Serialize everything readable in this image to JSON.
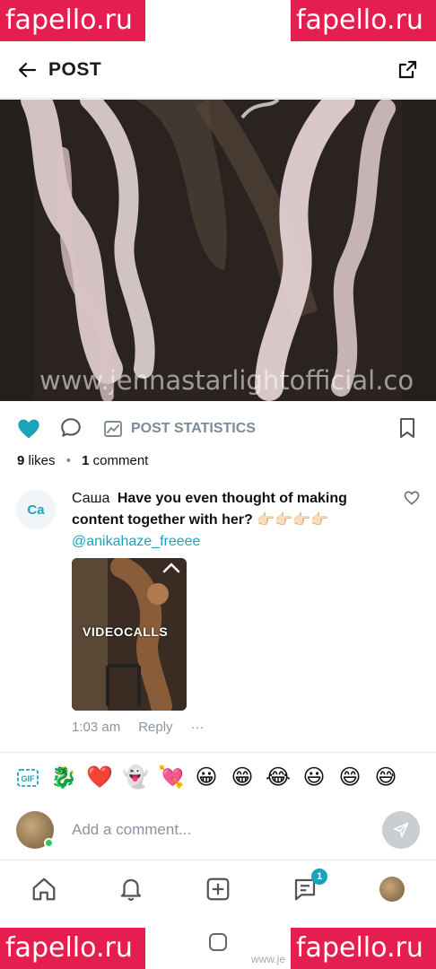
{
  "watermarks": {
    "top_left": "fapello.ru",
    "top_right": "fapello.ru",
    "bottom_left": "fapello.ru",
    "bottom_right": "fapello.ru",
    "bottom_small": "www.je"
  },
  "header": {
    "title": "POST",
    "back_icon": "arrow-left-icon",
    "share_icon": "share-icon"
  },
  "media": {
    "overlay_text": "www.jennastarlightofficial.co"
  },
  "actions": {
    "liked": true,
    "like_color": "#1aa4bc",
    "stats_label": "POST STATISTICS"
  },
  "counts": {
    "likes_num": "9",
    "likes_label": "likes",
    "comments_num": "1",
    "comments_label": "comment"
  },
  "comment": {
    "avatar_initials": "Ca",
    "author": "Саша",
    "text": "Have you even thought of making content together with her? 👉🏻👉🏻👉🏻👉🏻",
    "mention": "@anikahaze_freeee",
    "thumb_label": "VIDEOCALLS",
    "time": "1:03 am",
    "reply": "Reply",
    "more": "···"
  },
  "emoji_bar": {
    "gif_label": "GIF",
    "emojis": [
      "🐉",
      "❤️",
      "👻",
      "💘",
      "😀",
      "😁",
      "😂",
      "😃",
      "😄",
      "😅"
    ]
  },
  "composer": {
    "placeholder": "Add a comment..."
  },
  "nav": {
    "notification_badge": "1",
    "accent": "#1aa4bc"
  }
}
